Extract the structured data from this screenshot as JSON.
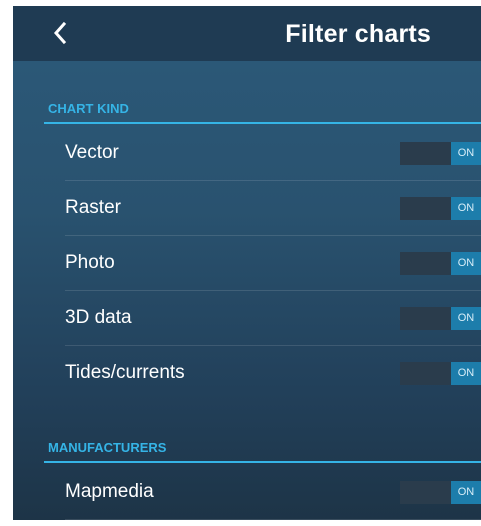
{
  "header": {
    "back_icon": "chevron-left-icon",
    "title": "Filter charts"
  },
  "colors": {
    "accent": "#35b4e6",
    "toggle_on": "#1d7dab",
    "header_bg": "#1f3b53"
  },
  "sections": [
    {
      "title": "CHART KIND",
      "items": [
        {
          "label": "Vector",
          "toggle": "ON"
        },
        {
          "label": "Raster",
          "toggle": "ON"
        },
        {
          "label": "Photo",
          "toggle": "ON"
        },
        {
          "label": "3D data",
          "toggle": "ON"
        },
        {
          "label": "Tides/currents",
          "toggle": "ON"
        }
      ]
    },
    {
      "title": "MANUFACTURERS",
      "items": [
        {
          "label": "Mapmedia",
          "toggle": "ON"
        }
      ]
    }
  ]
}
